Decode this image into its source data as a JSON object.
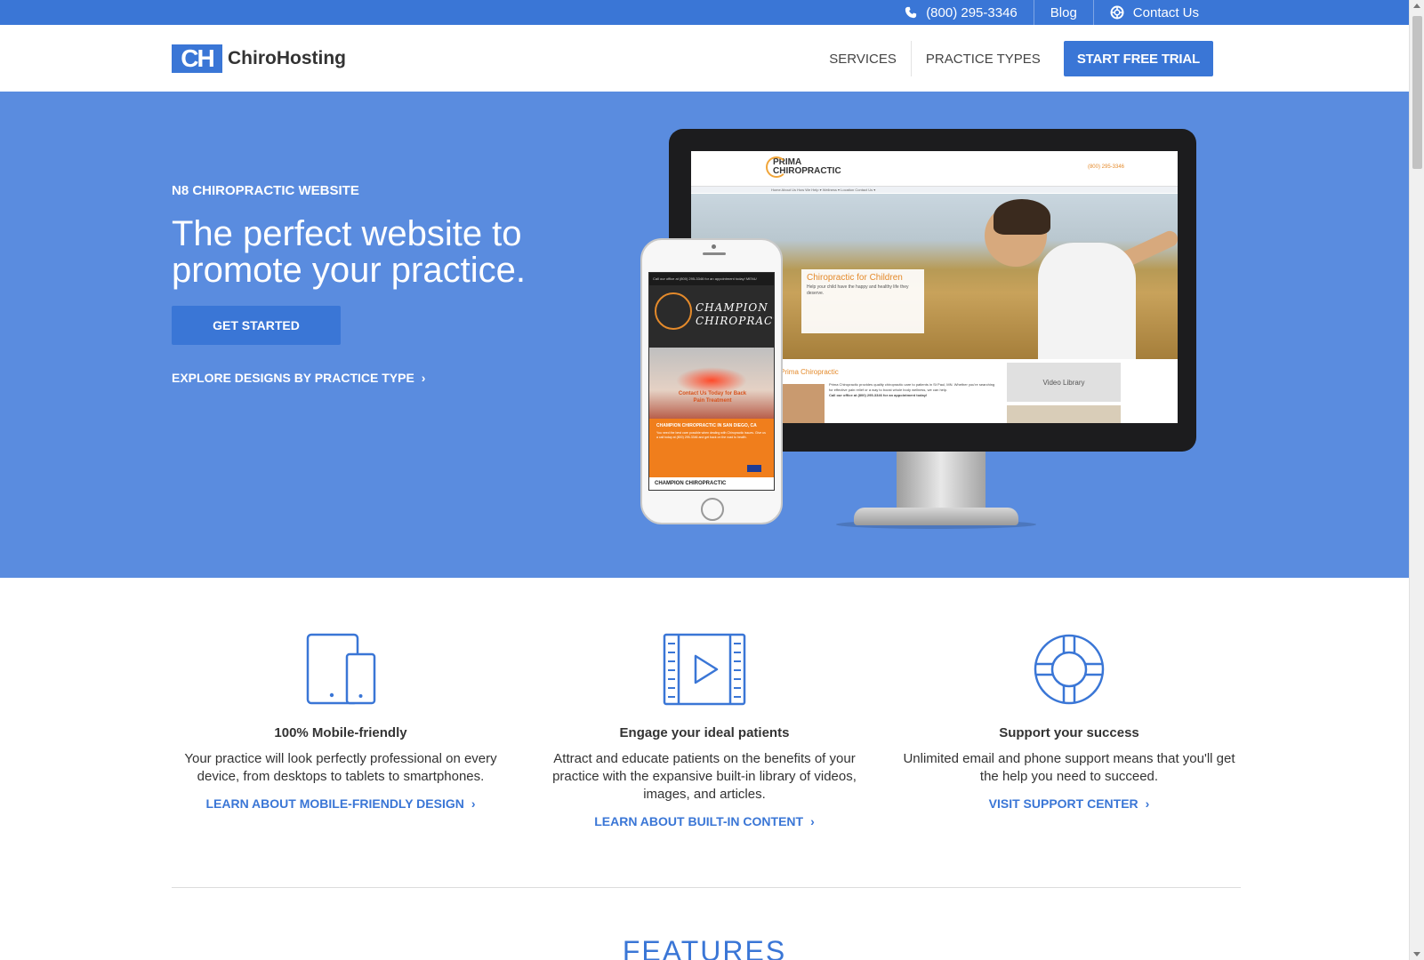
{
  "topbar": {
    "phone_label": "(800) 295-3346",
    "blog_label": "Blog",
    "contact_label": "Contact Us"
  },
  "header": {
    "logo_mark": "CH",
    "logo_text": "ChiroHosting",
    "nav": {
      "services": "SERVICES",
      "practice_types": "PRACTICE TYPES",
      "cta": "START FREE TRIAL"
    }
  },
  "hero": {
    "eyebrow": "N8 CHIROPRACTIC WEBSITE",
    "headline": "The perfect website to promote your practice.",
    "button_label": "GET STARTED",
    "explore_label": "EXPLORE DESIGNS BY PRACTICE TYPE",
    "desktop_mockup": {
      "site_name_line1": "PRIMA",
      "site_name_line2": "CHIROPRACTIC",
      "phone": "(800) 295-3346",
      "nav_items": "Home    About Us    How We Help ▾    Wellness ▾    Location    Contact Us ▾",
      "card_title": "Chiropractic for Children",
      "card_text": "Help your child have the happy and healthy life they deserve.",
      "section_title": "Prima Chiropractic",
      "section_text": "Prima Chiropractic provides quality chiropractic care to patients in St Paul, MN. Whether you're searching for effective pain relief or a way to boost whole body wellness, we can help.",
      "section_call": "Call our office at (800) 295-3346 for an appointment today!",
      "video_label": "Video Library"
    },
    "mobile_mockup": {
      "top_bar": "Call our office at (800) 295-3346 for an appointment today!   MENU",
      "name_line1": "CHAMPION",
      "name_line2": "CHIROPRACTIC",
      "image_caption": "Contact Us Today for Back Pain Treatment",
      "orange_title": "CHAMPION CHIROPRACTIC IN SAN DIEGO, CA",
      "orange_text": "You need the best care possible when dealing with Chiropractic issues. Give us a call today at (800) 295-3346 and get back on the road to health.",
      "footer_label": "CHAMPION CHIROPRACTIC"
    }
  },
  "features": [
    {
      "icon": "devices-icon",
      "title": "100% Mobile-friendly",
      "text": "Your practice will look perfectly professional on every device, from desktops to tablets to smartphones.",
      "link": "LEARN ABOUT MOBILE-FRIENDLY DESIGN"
    },
    {
      "icon": "film-play-icon",
      "title": "Engage your ideal patients",
      "text": "Attract and educate patients on the benefits of your practice with the expansive built-in library of videos, images, and articles.",
      "link": "LEARN ABOUT BUILT-IN CONTENT"
    },
    {
      "icon": "lifebuoy-icon",
      "title": "Support your success",
      "text": "Unlimited email and phone support means that you'll get the help you need to succeed.",
      "link": "VISIT SUPPORT CENTER"
    }
  ],
  "features_section_title": "FEATURES",
  "colors": {
    "brand_blue": "#3a76d6",
    "hero_blue": "#5a8cdf",
    "accent_orange": "#e48a2b"
  }
}
